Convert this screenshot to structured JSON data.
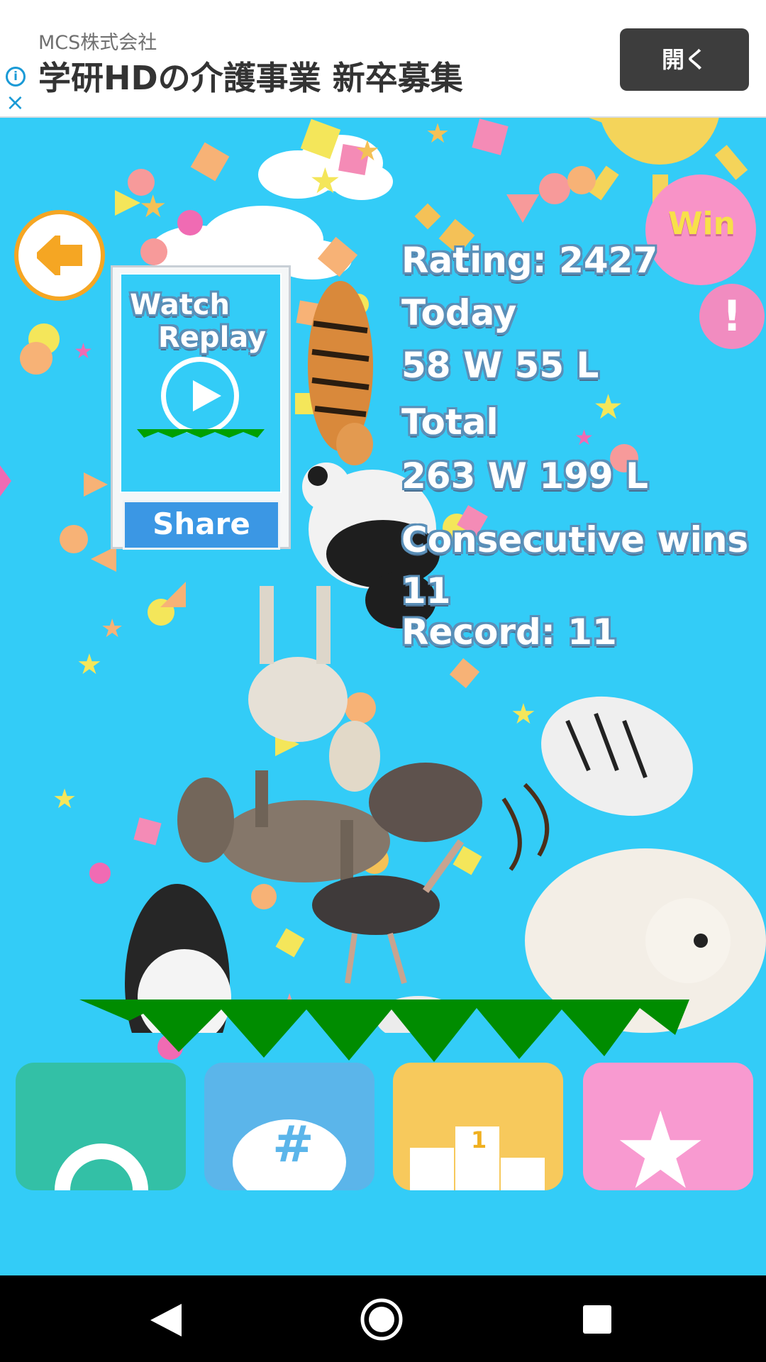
{
  "ad": {
    "company": "MCS株式会社",
    "headline": "学研HDの介護事業 新卒募集",
    "open_label": "開く",
    "info_icon": "i",
    "close_icon": "×"
  },
  "replay_card": {
    "watch": "Watch",
    "replay": "Replay",
    "share_label": "Share"
  },
  "win_badge": "Win",
  "alert_icon": "!",
  "stats": {
    "rating": "Rating: 2427",
    "today_label": "Today",
    "today_value": "58 W 55 L",
    "total_label": "Total",
    "total_value": "263 W 199 L",
    "consecutive_label": "Consecutive wins",
    "consecutive_value": "11",
    "record": "Record: 11"
  },
  "toolbar": {
    "retry_color": "#33c0a6",
    "hashtag_color": "#5bb5ea",
    "ranking_color": "#f7c95c",
    "favorite_color": "#f89ad0",
    "hashtag_glyph": "#",
    "ranking_glyph": "1"
  },
  "colors": {
    "background": "#33ccf7",
    "ground": "#008c00",
    "back_arrow": "#f5a623"
  }
}
